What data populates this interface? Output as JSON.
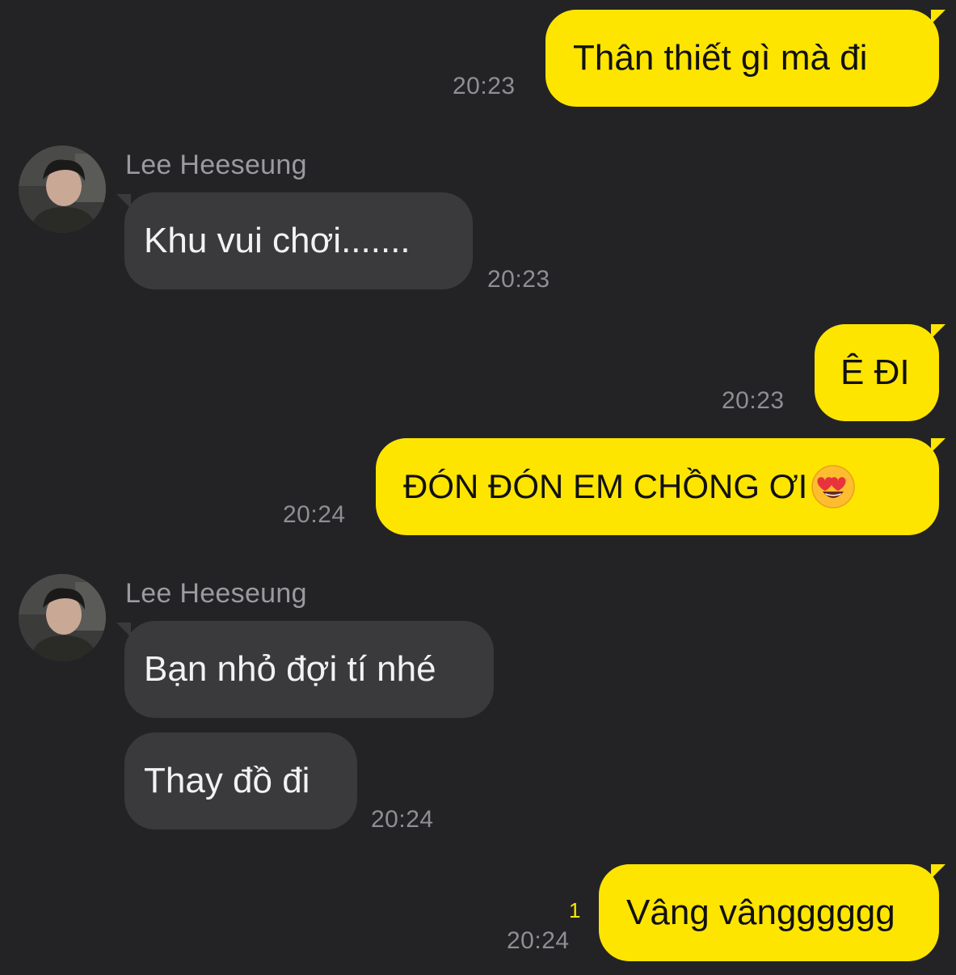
{
  "contact": {
    "name": "Lee Heeseung"
  },
  "messages": {
    "m1": {
      "text": "Thân thiết gì mà đi",
      "time": "20:23"
    },
    "m2": {
      "text": "Khu vui chơi.......",
      "time": "20:23"
    },
    "m3": {
      "text": "Ê ĐI",
      "time": "20:23"
    },
    "m4": {
      "text": "ĐÓN ĐÓN EM CHỒNG ƠI",
      "emoji": "heart-eyes-emoji",
      "time": "20:24"
    },
    "m5": {
      "text": "Bạn nhỏ đợi tí nhé"
    },
    "m6": {
      "text": "Thay đồ đi",
      "time": "20:24"
    },
    "m7": {
      "text": "Vâng vângggggg",
      "time": "20:24",
      "unread": "1"
    }
  },
  "colors": {
    "background": "#232325",
    "outgoing_bubble": "#fee500",
    "incoming_bubble": "#3a3a3c",
    "timestamp": "#8e8e93",
    "unread_count": "#fee500"
  }
}
